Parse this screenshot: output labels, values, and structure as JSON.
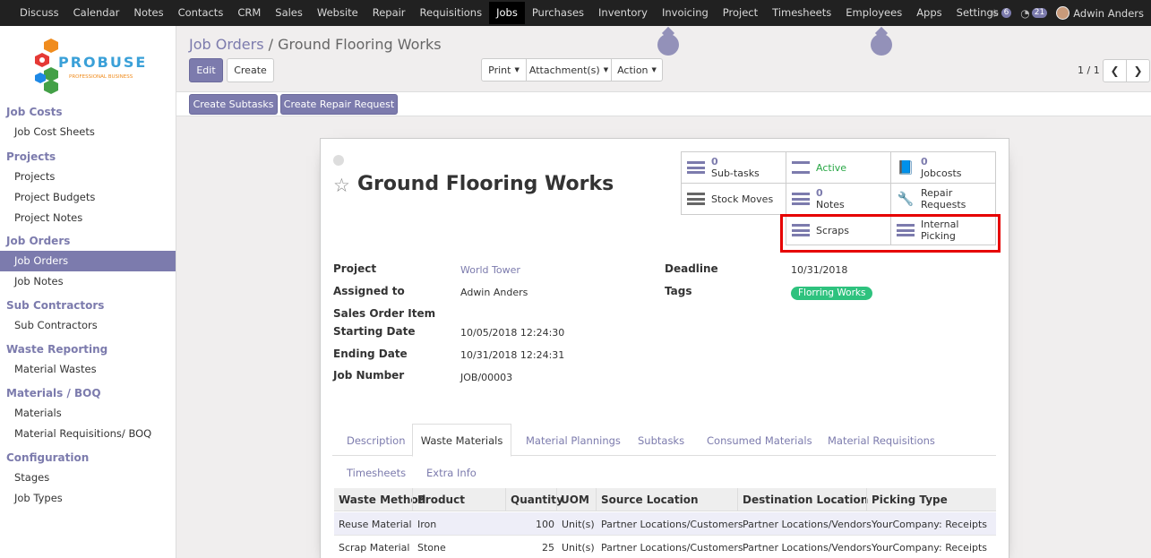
{
  "top_menu": {
    "items": [
      "Discuss",
      "Calendar",
      "Notes",
      "Contacts",
      "CRM",
      "Sales",
      "Website",
      "Repair",
      "Requisitions",
      "Jobs",
      "Purchases",
      "Inventory",
      "Invoicing",
      "Project",
      "Timesheets",
      "Employees",
      "Apps",
      "Settings"
    ],
    "active": "Jobs",
    "chat_count": "6",
    "activity_count": "21",
    "user_name": "Adwin Anders"
  },
  "logo": {
    "brand": "PROBUSE",
    "tagline": "PROFESSIONAL BUSINESS"
  },
  "sidebar": {
    "sections": [
      {
        "title": "Job Costs",
        "items": [
          "Job Cost Sheets"
        ]
      },
      {
        "title": "Projects",
        "items": [
          "Projects",
          "Project Budgets",
          "Project Notes"
        ]
      },
      {
        "title": "Job Orders",
        "items": [
          "Job Orders",
          "Job Notes"
        ]
      },
      {
        "title": "Sub Contractors",
        "items": [
          "Sub Contractors"
        ]
      },
      {
        "title": "Waste Reporting",
        "items": [
          "Material Wastes"
        ]
      },
      {
        "title": "Materials / BOQ",
        "items": [
          "Materials",
          "Material Requisitions/ BOQ"
        ]
      },
      {
        "title": "Configuration",
        "items": [
          "Stages",
          "Job Types"
        ]
      }
    ],
    "active_item": "Job Orders"
  },
  "breadcrumb": {
    "parent": "Job Orders",
    "separator": "/",
    "current": "Ground Flooring Works"
  },
  "buttons": {
    "edit": "Edit",
    "create": "Create",
    "print": "Print",
    "attachments": "Attachment(s)",
    "action": "Action",
    "create_subtasks": "Create Subtasks",
    "create_repair_request": "Create Repair Request"
  },
  "pager": {
    "value": "1 / 1"
  },
  "record": {
    "title": "Ground Flooring Works",
    "smart_buttons": {
      "subtasks": {
        "count": "0",
        "label": "Sub-tasks"
      },
      "active": {
        "label": "Active"
      },
      "jobcosts": {
        "count": "0",
        "label": "Jobcosts"
      },
      "stock_moves": {
        "label": "Stock Moves"
      },
      "notes": {
        "count": "0",
        "label": "Notes"
      },
      "repair_requests": {
        "label": "Repair Requests"
      },
      "scraps": {
        "label": "Scraps"
      },
      "internal_picking": {
        "label": "Internal Picking"
      }
    },
    "fields": {
      "project_label": "Project",
      "project": "World Tower",
      "assigned_label": "Assigned to",
      "assigned": "Adwin Anders",
      "so_item_label": "Sales Order Item",
      "start_label": "Starting Date",
      "start": "10/05/2018 12:24:30",
      "end_label": "Ending Date",
      "end": "10/31/2018 12:24:31",
      "job_number_label": "Job Number",
      "job_number": "JOB/00003",
      "deadline_label": "Deadline",
      "deadline": "10/31/2018",
      "tags_label": "Tags",
      "tag": "Florring Works"
    },
    "tabs": [
      "Description",
      "Waste Materials",
      "Material Plannings",
      "Subtasks",
      "Consumed Materials",
      "Material Requisitions",
      "Timesheets",
      "Extra Info"
    ],
    "active_tab": "Waste Materials",
    "table": {
      "headers": [
        "Waste Method",
        "Product",
        "Quantity",
        "UOM",
        "Source Location",
        "Destination Location",
        "Picking Type"
      ],
      "rows": [
        [
          "Reuse Material",
          "Iron",
          "100",
          "Unit(s)",
          "Partner Locations/Customers",
          "Partner Locations/Vendors",
          "YourCompany: Receipts"
        ],
        [
          "Scrap Material",
          "Stone",
          "25",
          "Unit(s)",
          "Partner Locations/Customers",
          "Partner Locations/Vendors",
          "YourCompany: Receipts"
        ]
      ]
    }
  },
  "colors": {
    "accent": "#7c7bad",
    "navbar": "#212121",
    "highlight": "#e60000",
    "tag": "#2ec27e"
  }
}
